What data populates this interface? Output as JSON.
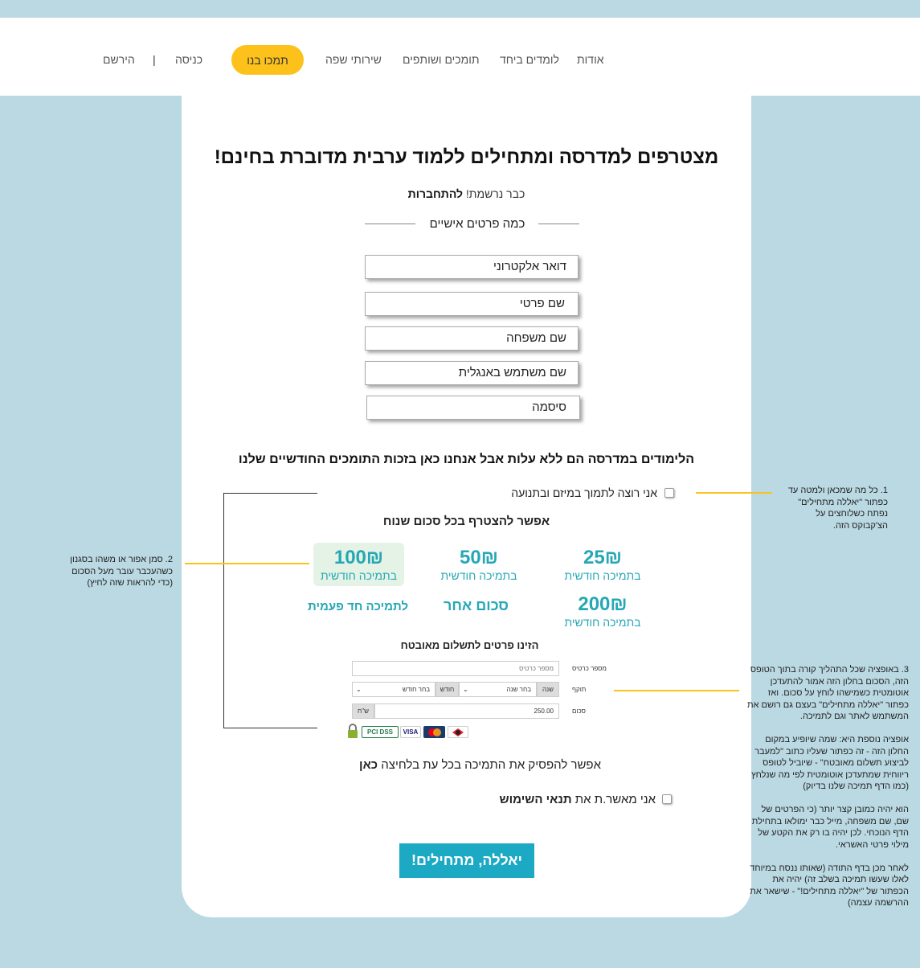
{
  "nav": {
    "about": "אודות",
    "learn_together": "לומדים ביחד",
    "supporters": "תומכים ושותפים",
    "language_services": "שירותי שפה",
    "support_us": "תמכו בנו",
    "login": "כניסה",
    "separator": "|",
    "register": "הירשם"
  },
  "page": {
    "title": "מצטרפים למדרסה ומתחילים ללמוד ערבית מדוברת בחינם!",
    "already_registered": "כבר נרשמת!",
    "login_link": "להתחברות",
    "personal_section": "כמה פרטים אישיים"
  },
  "fields": {
    "email": "דואר אלקטרוני",
    "first_name": "שם פרטי",
    "last_name": "שם משפחה",
    "english_username": "שם משתמש באנגלית",
    "password": "סיסמה"
  },
  "support": {
    "heading": "הלימודים במדרסה הם ללא עלות אבל אנחנו כאן בזכות התומכים החודשיים שלנו",
    "want_support": "אני רוצה לתמוך במיזם ובתנועה",
    "any_amount": "אפשר להצטרף בכל סכום שנוח",
    "monthly_label": "בתמיכה חודשית",
    "amounts": [
      "25₪",
      "50₪",
      "100₪",
      "200₪"
    ],
    "other_amount": "סכום אחר",
    "one_time": "לתמיכה חד פעמית",
    "secure_payment": "הזינו פרטים לתשלום מאובטח",
    "cancel_text": "אפשר להפסיק את התמיכה בכל עת בלחיצה",
    "cancel_link": "כאן"
  },
  "payment": {
    "card_label": "מספר כרטיס",
    "card_placeholder": "מספר כרטיס",
    "expiry_label": "תוקף",
    "year_label": "שנה",
    "year_select": "בחר שנה",
    "month_label": "חודש",
    "month_select": "בחר חודש",
    "amount_label": "סכום",
    "amount_value": "250.00",
    "currency": "ש\"ח",
    "logos": [
      "PCI DSS",
      "VISA",
      "MasterCard",
      "Diners"
    ]
  },
  "terms": {
    "text": "אני מאשר.ת את",
    "link": "תנאי השימוש"
  },
  "cta": "יאללה, מתחילים!",
  "annotations": {
    "note1": [
      "1. כל מה שמכאן ולמטה עד",
      "כפתור \"יאללה מתחילים\"",
      "נפתח כשלוחצים על",
      "הצ'קבוקס הזה."
    ],
    "note2": [
      "2. סמן אפור או משהו בסגנון",
      "כשהעכבר עובר מעל הסכום",
      "(כדי להראות שזה לחיץ)"
    ],
    "note3": [
      "3. באופציה שכל התהליך קורה בתוך הטופס",
      "הזה, הסכום בחלון הזה אמור להתעדכן",
      "אוטומטית כשמישהו לוחץ על סכום. ואז",
      "כפתור \"יאללה מתחילים\" בעצם גם רושם את",
      "המשתמש לאתר וגם לתמיכה.",
      "",
      "אופציה נוספת היא: שמה שיופיע במקום",
      "החלון הזה - זה כפתור שעליו כתוב \"למעבר",
      "לביצוע תשלום מאובטח\" - שיוביל לטופס",
      "ריווחית שמתעדכן אוטומטית לפי מה שנלחץ",
      "(כמו הדף תמיכה שלנו בדיוק)",
      "",
      "הוא יהיה כמובן קצר יותר (כי הפרטים של",
      "שם, שם משפחה, מייל כבר ימולאו בתחילת",
      "הדף הנוכחי. לכן יהיה בו רק את הקטע של",
      "מילוי פרטי האשראי.",
      "",
      "לאחר מכן בדף התודה (שאותו ננסח במיוחד",
      "לאלו שעשו תמיכה בשלב זה) יהיה את",
      "הכפתור של \"יאללה מתחילים!\" - שישאר את",
      "ההרשמה עצמה)"
    ]
  }
}
